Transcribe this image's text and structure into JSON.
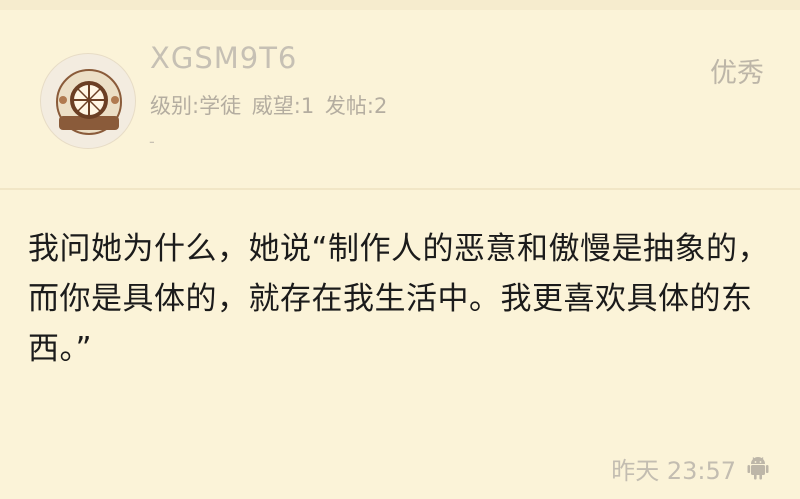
{
  "post": {
    "username": "XGSM9T6",
    "meta": {
      "level": "级别:学徒",
      "prestige": "威望:1",
      "posts": "发帖:2"
    },
    "signature": "-",
    "rating": "优秀",
    "content": "我问她为什么，她说“制作人的恶意和傲慢是抽象的，而你是具体的，就存在我生活中。我更喜欢具体的东西。”",
    "time": "昨天 23:57",
    "device_icon": "android-icon"
  },
  "colors": {
    "background": "#fbf3d8",
    "text": "#1b1b1b",
    "muted": "#bdb6a8"
  }
}
